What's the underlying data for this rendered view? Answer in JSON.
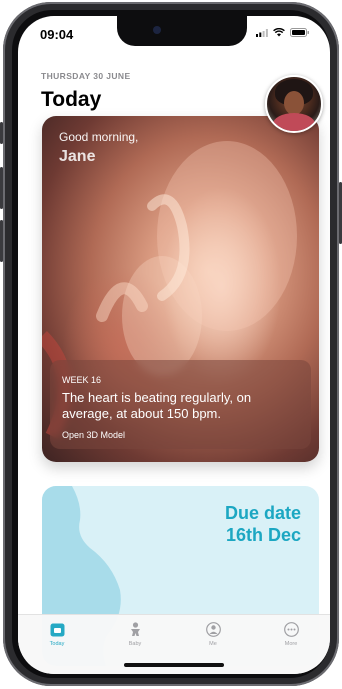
{
  "status_bar": {
    "time": "09:04"
  },
  "header": {
    "date": "THURSDAY 30 JUNE",
    "title": "Today"
  },
  "hero_card": {
    "greeting": "Good morning,",
    "name": "Jane",
    "week": "WEEK 16",
    "message": "The heart is beating regularly, on average, at about 150 bpm.",
    "link": "Open 3D Model"
  },
  "due_card": {
    "line1": "Due date",
    "line2": "16th Dec"
  },
  "tabs": [
    {
      "label": "Today",
      "icon": "calendar-icon",
      "active": true
    },
    {
      "label": "Baby",
      "icon": "baby-icon",
      "active": false
    },
    {
      "label": "Me",
      "icon": "person-icon",
      "active": false
    },
    {
      "label": "More",
      "icon": "more-icon",
      "active": false
    }
  ],
  "colors": {
    "accent": "#25a9c4",
    "due_text": "#1ca7c2",
    "due_bg": "#d9f1f7"
  }
}
